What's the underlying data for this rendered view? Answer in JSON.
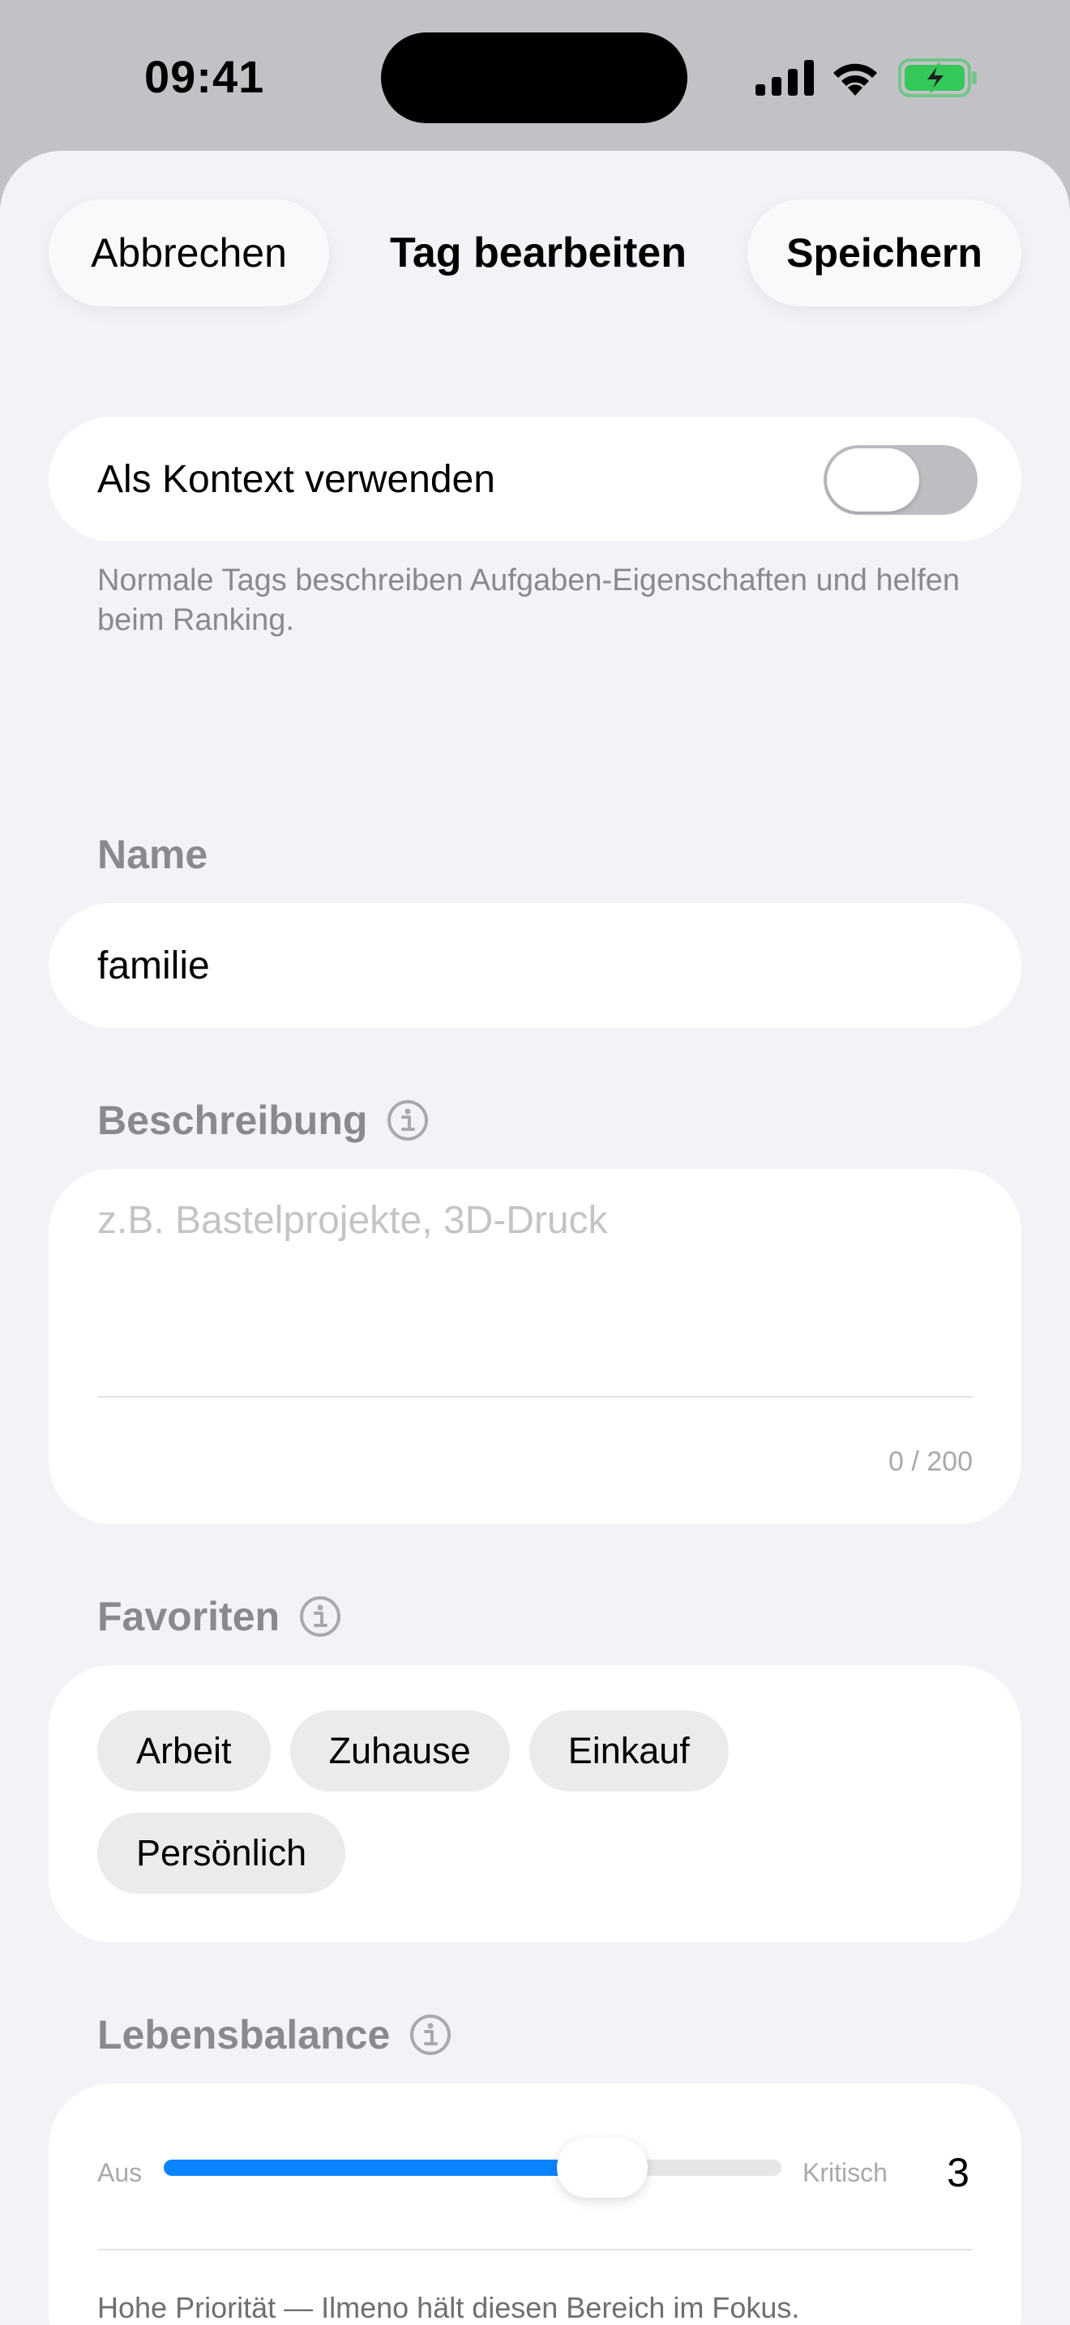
{
  "status_bar": {
    "time": "09:41"
  },
  "sheet": {
    "title": "Tag bearbeiten",
    "cancel_label": "Abbrechen",
    "save_label": "Speichern"
  },
  "context_toggle": {
    "label": "Als Kontext verwenden",
    "enabled": false,
    "footnote": "Normale Tags beschreiben Aufgaben-Eigenschaften und helfen beim Ranking."
  },
  "name": {
    "label": "Name",
    "value": "familie"
  },
  "description": {
    "label": "Beschreibung",
    "value": "",
    "placeholder": "z.B. Bastelprojekte, 3D-Druck",
    "char_count": "0 / 200"
  },
  "favorites": {
    "label": "Favoriten",
    "items": [
      {
        "label": "Arbeit"
      },
      {
        "label": "Zuhause"
      },
      {
        "label": "Einkauf"
      },
      {
        "label": "Persönlich"
      }
    ]
  },
  "life_balance": {
    "label": "Lebensbalance",
    "min_label": "Aus",
    "max_label": "Kritisch",
    "value": "3",
    "fill_fraction": 0.71,
    "caption": "Hohe Priorität — Ilmeno hält diesen Bereich im Fokus."
  },
  "colors": {
    "accent": "#0a84ff",
    "battery": "#34c759",
    "background": "#f2f2f7"
  }
}
